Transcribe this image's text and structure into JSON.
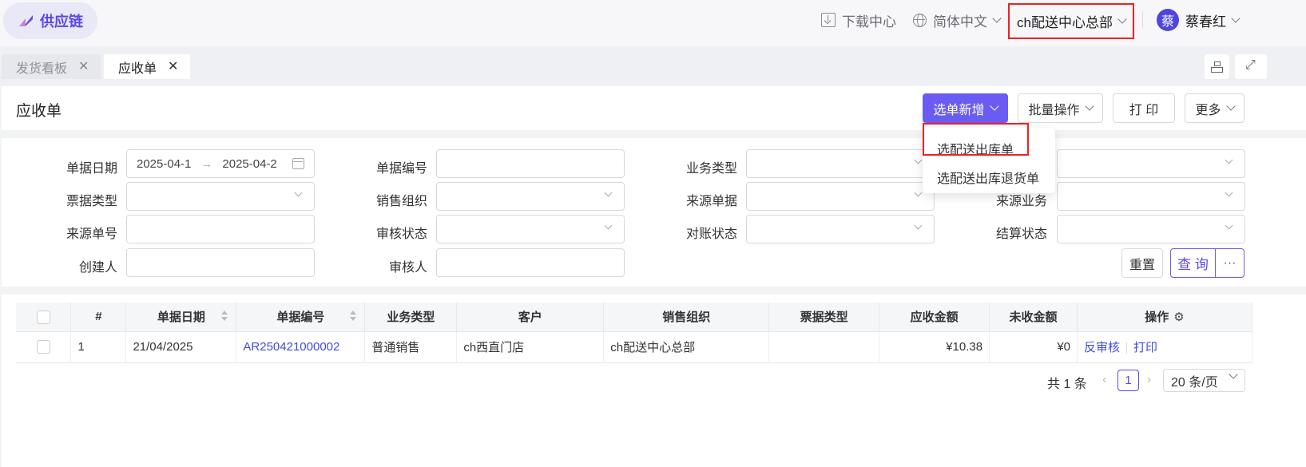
{
  "app": {
    "logo_text": "供应链"
  },
  "topbar": {
    "download": "下载中心",
    "language": "简体中文",
    "org": "ch配送中心总部",
    "avatar_char": "蔡",
    "user_name": "蔡春红"
  },
  "tabs": [
    {
      "label": "发货看板",
      "active": false
    },
    {
      "label": "应收单",
      "active": true
    }
  ],
  "page": {
    "title": "应收单",
    "buttons": {
      "add": "选单新增",
      "batch": "批量操作",
      "print": "打 印",
      "more": "更多"
    }
  },
  "dropdown": {
    "items": [
      "选配送出库单",
      "选配送出库退货单"
    ]
  },
  "filters": {
    "doc_date": {
      "label": "单据日期",
      "start": "2025-04-1",
      "end": "2025-04-2"
    },
    "doc_no": "单据编号",
    "biz_type": "业务类型",
    "invoice_type": "票据类型",
    "sales_org": "销售组织",
    "source_doc": "来源单据",
    "source_biz": "来源业务",
    "source_no": "来源单号",
    "audit_status": "审核状态",
    "recon_status": "对账状态",
    "settle_status": "结算状态",
    "creator": "创建人",
    "auditor": "审核人",
    "reset": "重置",
    "query": "查 询",
    "query_more": "···"
  },
  "table": {
    "headers": [
      "#",
      "单据日期",
      "单据编号",
      "业务类型",
      "客户",
      "销售组织",
      "票据类型",
      "应收金额",
      "未收金额",
      "操作"
    ],
    "rows": [
      {
        "index": "1",
        "date": "21/04/2025",
        "no": "AR250421000002",
        "biz_type": "普通销售",
        "customer": "ch西直门店",
        "sales_org": "ch配送中心总部",
        "invoice_type": "",
        "receivable": "¥10.38",
        "unreceived": "¥0",
        "op_unaudit": "反审核",
        "op_print": "打印"
      }
    ]
  },
  "pager": {
    "total": "共 1 条",
    "current": "1",
    "page_size": "20 条/页"
  },
  "colors": {
    "accent": "#6a5cf2",
    "highlight_box": "#f02020",
    "link": "#3e4ce0"
  }
}
